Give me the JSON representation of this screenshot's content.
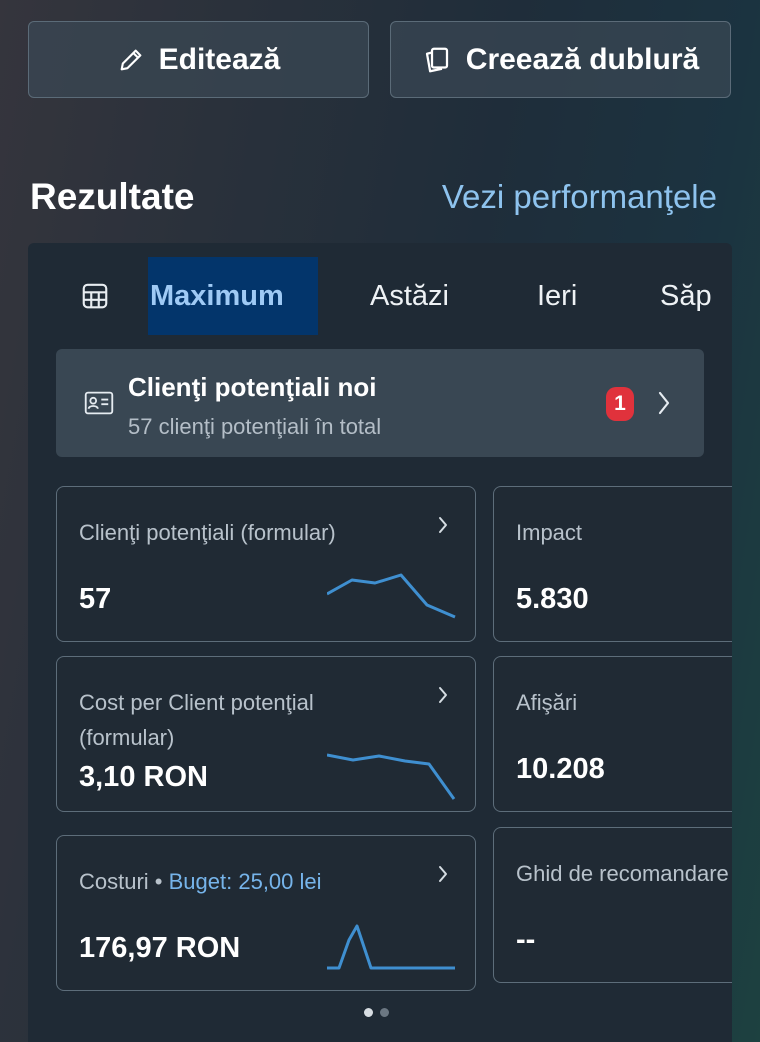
{
  "actions": {
    "edit_label": "Editează",
    "duplicate_label": "Creează dublură"
  },
  "results": {
    "title": "Rezultate",
    "performance_link": "Vezi performanţele"
  },
  "tabs": [
    {
      "label": "Maximum",
      "active": true
    },
    {
      "label": "Astăzi",
      "active": false
    },
    {
      "label": "Ieri",
      "active": false
    },
    {
      "label": "Săp",
      "active": false
    }
  ],
  "leads_card": {
    "title": "Clienţi potenţiali noi",
    "subtitle": "57 clienţi potenţiali în total",
    "badge": "1"
  },
  "metrics": {
    "leads": {
      "label": "Clienţi potenţiali (formular)",
      "value": "57"
    },
    "cpl": {
      "label_line1": "Cost per Client potenţial",
      "label_line2": "(formular)",
      "value": "3,10 RON"
    },
    "costs": {
      "label": "Costuri",
      "separator": " • ",
      "budget": "Buget: 25,00 lei",
      "value": "176,97 RON"
    },
    "impact": {
      "label": "Impact",
      "value": "5.830"
    },
    "impressions": {
      "label": "Afişări",
      "value": "10.208"
    },
    "guide": {
      "label": "Ghid de recomandare",
      "value": "--"
    }
  },
  "pagination": {
    "pages": 2,
    "current": 1
  },
  "colors": {
    "accent": "#8ec3ee",
    "active_tab_bg": "#03356b",
    "badge": "#e0323c",
    "sparkline": "#3f8fd0"
  },
  "icons": {
    "edit": "pencil-icon",
    "duplicate": "copy-icon",
    "table": "table-icon",
    "leads": "contact-card-icon",
    "chevron": "chevron-right-icon"
  }
}
